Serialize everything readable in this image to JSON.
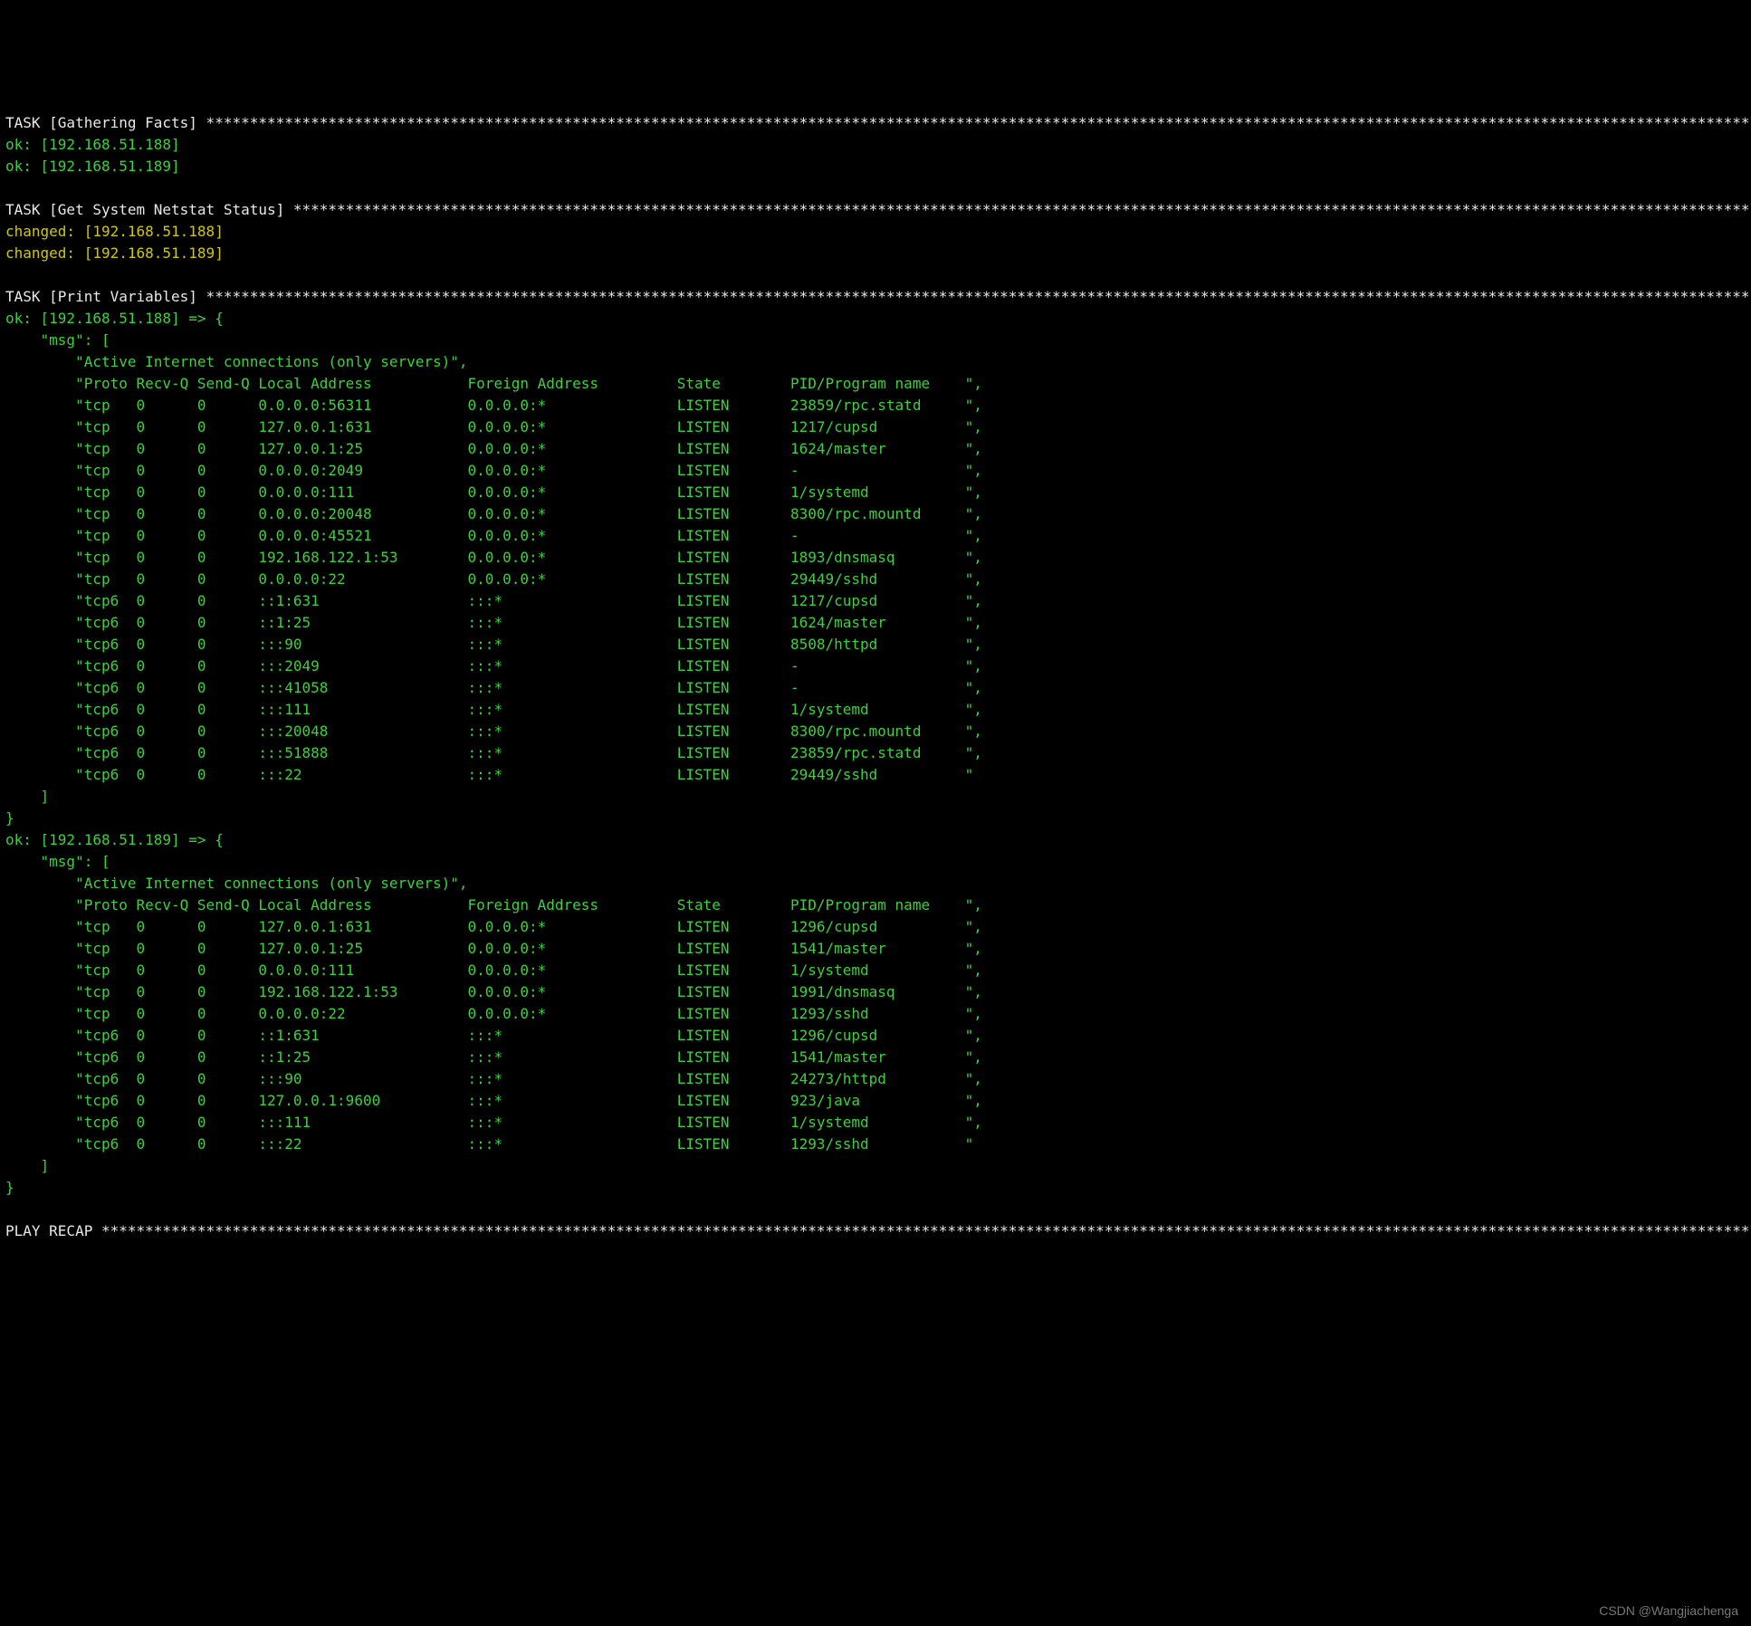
{
  "star_width": 230,
  "tasks": [
    {
      "name": "Gathering Facts",
      "lines": [
        {
          "status": "ok",
          "host": "192.168.51.188"
        },
        {
          "status": "ok",
          "host": "192.168.51.189"
        }
      ]
    },
    {
      "name": "Get System Netstat Status",
      "lines": [
        {
          "status": "changed",
          "host": "192.168.51.188"
        },
        {
          "status": "changed",
          "host": "192.168.51.189"
        }
      ]
    },
    {
      "name": "Print Variables",
      "results": [
        {
          "host": "192.168.51.188",
          "msg_header": "Active Internet connections (only servers)",
          "columns": [
            "Proto",
            "Recv-Q",
            "Send-Q",
            "Local Address",
            "Foreign Address",
            "State",
            "PID/Program name"
          ],
          "rows": [
            {
              "proto": "tcp",
              "recvq": "0",
              "sendq": "0",
              "local": "0.0.0.0:56311",
              "foreign": "0.0.0.0:*",
              "state": "LISTEN",
              "pid": "23859/rpc.statd",
              "tail": ","
            },
            {
              "proto": "tcp",
              "recvq": "0",
              "sendq": "0",
              "local": "127.0.0.1:631",
              "foreign": "0.0.0.0:*",
              "state": "LISTEN",
              "pid": "1217/cupsd",
              "tail": ","
            },
            {
              "proto": "tcp",
              "recvq": "0",
              "sendq": "0",
              "local": "127.0.0.1:25",
              "foreign": "0.0.0.0:*",
              "state": "LISTEN",
              "pid": "1624/master",
              "tail": ","
            },
            {
              "proto": "tcp",
              "recvq": "0",
              "sendq": "0",
              "local": "0.0.0.0:2049",
              "foreign": "0.0.0.0:*",
              "state": "LISTEN",
              "pid": "-",
              "tail": ","
            },
            {
              "proto": "tcp",
              "recvq": "0",
              "sendq": "0",
              "local": "0.0.0.0:111",
              "foreign": "0.0.0.0:*",
              "state": "LISTEN",
              "pid": "1/systemd",
              "tail": ","
            },
            {
              "proto": "tcp",
              "recvq": "0",
              "sendq": "0",
              "local": "0.0.0.0:20048",
              "foreign": "0.0.0.0:*",
              "state": "LISTEN",
              "pid": "8300/rpc.mountd",
              "tail": ","
            },
            {
              "proto": "tcp",
              "recvq": "0",
              "sendq": "0",
              "local": "0.0.0.0:45521",
              "foreign": "0.0.0.0:*",
              "state": "LISTEN",
              "pid": "-",
              "tail": ","
            },
            {
              "proto": "tcp",
              "recvq": "0",
              "sendq": "0",
              "local": "192.168.122.1:53",
              "foreign": "0.0.0.0:*",
              "state": "LISTEN",
              "pid": "1893/dnsmasq",
              "tail": ","
            },
            {
              "proto": "tcp",
              "recvq": "0",
              "sendq": "0",
              "local": "0.0.0.0:22",
              "foreign": "0.0.0.0:*",
              "state": "LISTEN",
              "pid": "29449/sshd",
              "tail": ","
            },
            {
              "proto": "tcp6",
              "recvq": "0",
              "sendq": "0",
              "local": "::1:631",
              "foreign": ":::*",
              "state": "LISTEN",
              "pid": "1217/cupsd",
              "tail": ","
            },
            {
              "proto": "tcp6",
              "recvq": "0",
              "sendq": "0",
              "local": "::1:25",
              "foreign": ":::*",
              "state": "LISTEN",
              "pid": "1624/master",
              "tail": ","
            },
            {
              "proto": "tcp6",
              "recvq": "0",
              "sendq": "0",
              "local": ":::90",
              "foreign": ":::*",
              "state": "LISTEN",
              "pid": "8508/httpd",
              "tail": ","
            },
            {
              "proto": "tcp6",
              "recvq": "0",
              "sendq": "0",
              "local": ":::2049",
              "foreign": ":::*",
              "state": "LISTEN",
              "pid": "-",
              "tail": ","
            },
            {
              "proto": "tcp6",
              "recvq": "0",
              "sendq": "0",
              "local": ":::41058",
              "foreign": ":::*",
              "state": "LISTEN",
              "pid": "-",
              "tail": ","
            },
            {
              "proto": "tcp6",
              "recvq": "0",
              "sendq": "0",
              "local": ":::111",
              "foreign": ":::*",
              "state": "LISTEN",
              "pid": "1/systemd",
              "tail": ","
            },
            {
              "proto": "tcp6",
              "recvq": "0",
              "sendq": "0",
              "local": ":::20048",
              "foreign": ":::*",
              "state": "LISTEN",
              "pid": "8300/rpc.mountd",
              "tail": ","
            },
            {
              "proto": "tcp6",
              "recvq": "0",
              "sendq": "0",
              "local": ":::51888",
              "foreign": ":::*",
              "state": "LISTEN",
              "pid": "23859/rpc.statd",
              "tail": ","
            },
            {
              "proto": "tcp6",
              "recvq": "0",
              "sendq": "0",
              "local": ":::22",
              "foreign": ":::*",
              "state": "LISTEN",
              "pid": "29449/sshd",
              "tail": ""
            }
          ]
        },
        {
          "host": "192.168.51.189",
          "msg_header": "Active Internet connections (only servers)",
          "columns": [
            "Proto",
            "Recv-Q",
            "Send-Q",
            "Local Address",
            "Foreign Address",
            "State",
            "PID/Program name"
          ],
          "rows": [
            {
              "proto": "tcp",
              "recvq": "0",
              "sendq": "0",
              "local": "127.0.0.1:631",
              "foreign": "0.0.0.0:*",
              "state": "LISTEN",
              "pid": "1296/cupsd",
              "tail": ","
            },
            {
              "proto": "tcp",
              "recvq": "0",
              "sendq": "0",
              "local": "127.0.0.1:25",
              "foreign": "0.0.0.0:*",
              "state": "LISTEN",
              "pid": "1541/master",
              "tail": ","
            },
            {
              "proto": "tcp",
              "recvq": "0",
              "sendq": "0",
              "local": "0.0.0.0:111",
              "foreign": "0.0.0.0:*",
              "state": "LISTEN",
              "pid": "1/systemd",
              "tail": ","
            },
            {
              "proto": "tcp",
              "recvq": "0",
              "sendq": "0",
              "local": "192.168.122.1:53",
              "foreign": "0.0.0.0:*",
              "state": "LISTEN",
              "pid": "1991/dnsmasq",
              "tail": ","
            },
            {
              "proto": "tcp",
              "recvq": "0",
              "sendq": "0",
              "local": "0.0.0.0:22",
              "foreign": "0.0.0.0:*",
              "state": "LISTEN",
              "pid": "1293/sshd",
              "tail": ","
            },
            {
              "proto": "tcp6",
              "recvq": "0",
              "sendq": "0",
              "local": "::1:631",
              "foreign": ":::*",
              "state": "LISTEN",
              "pid": "1296/cupsd",
              "tail": ","
            },
            {
              "proto": "tcp6",
              "recvq": "0",
              "sendq": "0",
              "local": "::1:25",
              "foreign": ":::*",
              "state": "LISTEN",
              "pid": "1541/master",
              "tail": ","
            },
            {
              "proto": "tcp6",
              "recvq": "0",
              "sendq": "0",
              "local": ":::90",
              "foreign": ":::*",
              "state": "LISTEN",
              "pid": "24273/httpd",
              "tail": ","
            },
            {
              "proto": "tcp6",
              "recvq": "0",
              "sendq": "0",
              "local": "127.0.0.1:9600",
              "foreign": ":::*",
              "state": "LISTEN",
              "pid": "923/java",
              "tail": ","
            },
            {
              "proto": "tcp6",
              "recvq": "0",
              "sendq": "0",
              "local": ":::111",
              "foreign": ":::*",
              "state": "LISTEN",
              "pid": "1/systemd",
              "tail": ","
            },
            {
              "proto": "tcp6",
              "recvq": "0",
              "sendq": "0",
              "local": ":::22",
              "foreign": ":::*",
              "state": "LISTEN",
              "pid": "1293/sshd",
              "tail": ""
            }
          ]
        }
      ]
    }
  ],
  "recap_label": "PLAY RECAP",
  "watermark": "CSDN @Wangjiachenga"
}
